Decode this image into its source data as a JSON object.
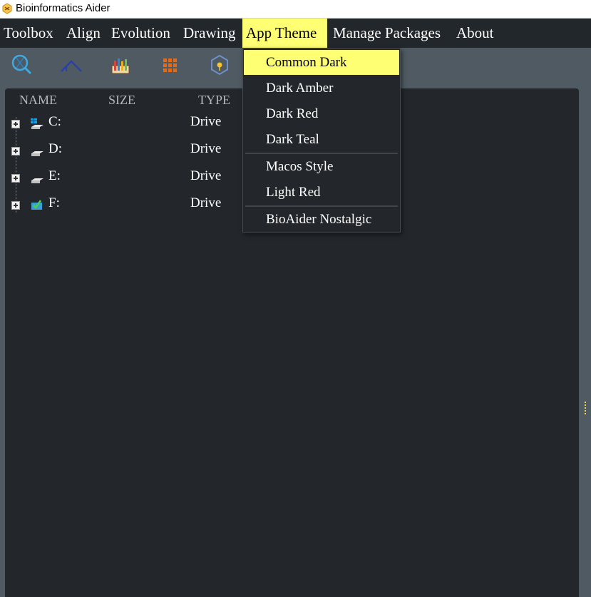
{
  "window": {
    "title": "Bioinformatics Aider",
    "icon": "bioaider-logo-icon"
  },
  "menubar": {
    "items": [
      {
        "label": "Toolbox"
      },
      {
        "label": "Align"
      },
      {
        "label": "Evolution"
      },
      {
        "label": "Drawing"
      },
      {
        "label": "App Theme",
        "active": true
      },
      {
        "label": "Manage Packages"
      },
      {
        "label": "About"
      }
    ]
  },
  "toolbar": {
    "tools": [
      {
        "icon": "dna-search-icon"
      },
      {
        "icon": "phylogeny-tree-icon"
      },
      {
        "icon": "chart-tool-icon"
      },
      {
        "icon": "grid-table-icon"
      },
      {
        "icon": "hexagon-model-icon"
      }
    ]
  },
  "file_browser": {
    "columns": [
      "NAME",
      "SIZE",
      "TYPE"
    ],
    "rows": [
      {
        "name": "C:",
        "type": "Drive",
        "icon": "windows-drive-icon"
      },
      {
        "name": "D:",
        "type": "Drive",
        "icon": "hard-drive-icon"
      },
      {
        "name": "E:",
        "type": "Drive",
        "icon": "hard-drive-icon"
      },
      {
        "name": "F:",
        "type": "Drive",
        "icon": "usb-drive-icon"
      }
    ]
  },
  "theme_menu": {
    "items": [
      {
        "label": "Common Dark",
        "selected": true
      },
      {
        "label": "Dark Amber"
      },
      {
        "label": "Dark Red"
      },
      {
        "label": "Dark Teal"
      },
      {
        "label": "Macos Style"
      },
      {
        "label": "Light Red"
      },
      {
        "label": "BioAider Nostalgic"
      }
    ]
  },
  "colors": {
    "menubar_bg": "#22272b",
    "highlight": "#ffff73",
    "panel_bg": "#23272b",
    "toolbar_bg": "#4f5a62"
  }
}
